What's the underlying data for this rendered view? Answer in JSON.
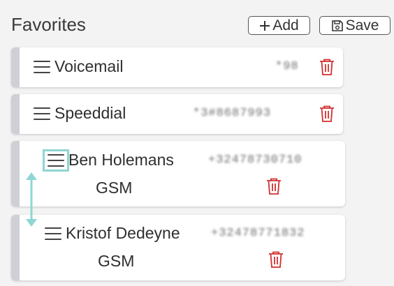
{
  "header": {
    "title": "Favorites"
  },
  "toolbar": {
    "add_label": "Add",
    "save_label": "Save"
  },
  "favorites": [
    {
      "name": "Voicemail",
      "type": "",
      "number": "*98"
    },
    {
      "name": "Speeddial",
      "type": "",
      "number": "*3#8687993"
    },
    {
      "name": "Ben Holemans",
      "type": "GSM",
      "number": "+32478730710"
    },
    {
      "name": "Kristof Dedeyne",
      "type": "GSM",
      "number": "+32478771832"
    }
  ],
  "colors": {
    "delete": "#d32f2f",
    "focus": "#8fd6d3",
    "card_accent": "#cfd0d6"
  },
  "icons": [
    "plus-icon",
    "floppy-disk-icon",
    "drag-handle-icon",
    "trash-icon",
    "double-arrow-icon"
  ]
}
